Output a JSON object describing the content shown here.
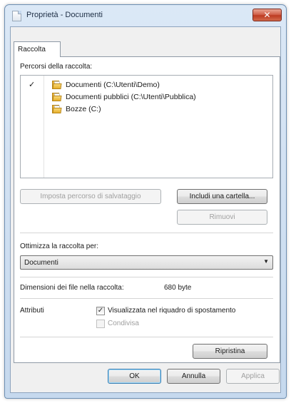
{
  "window": {
    "title": "Proprietà - Documenti",
    "close_label": "✕"
  },
  "tabs": [
    {
      "label": "Raccolta"
    }
  ],
  "library": {
    "locations_label": "Percorsi della raccolta:",
    "items": [
      {
        "label": "Documenti (C:\\Utenti\\Demo)",
        "checked": true,
        "check": "✓",
        "icon": "folder-icon"
      },
      {
        "label": "Documenti pubblici (C:\\Utenti\\Pubblica)",
        "checked": false,
        "check": "",
        "icon": "folder-icon"
      },
      {
        "label": "Bozze (C:)",
        "checked": false,
        "check": "",
        "icon": "folder-icon"
      }
    ],
    "set_save_location_button": "Imposta percorso di salvataggio",
    "include_folder_button": "Includi una cartella...",
    "remove_button": "Rimuovi"
  },
  "optimize": {
    "label": "Ottimizza la raccolta per:",
    "selected": "Documenti"
  },
  "size": {
    "label": "Dimensioni dei file nella raccolta:",
    "value": "680 byte"
  },
  "attributes": {
    "label": "Attributi",
    "shown_in_nav": {
      "label": "Visualizzata nel riquadro di spostamento",
      "checked": true,
      "check": "✓"
    },
    "shared": {
      "label": "Condivisa",
      "checked": false,
      "check": ""
    }
  },
  "restore_button": "Ripristina",
  "footer": {
    "ok": "OK",
    "cancel": "Annulla",
    "apply": "Applica"
  },
  "colors": {
    "close_button": "#c9452c",
    "title_bar": "#c6d9ee",
    "folder": "#e7b33c"
  }
}
